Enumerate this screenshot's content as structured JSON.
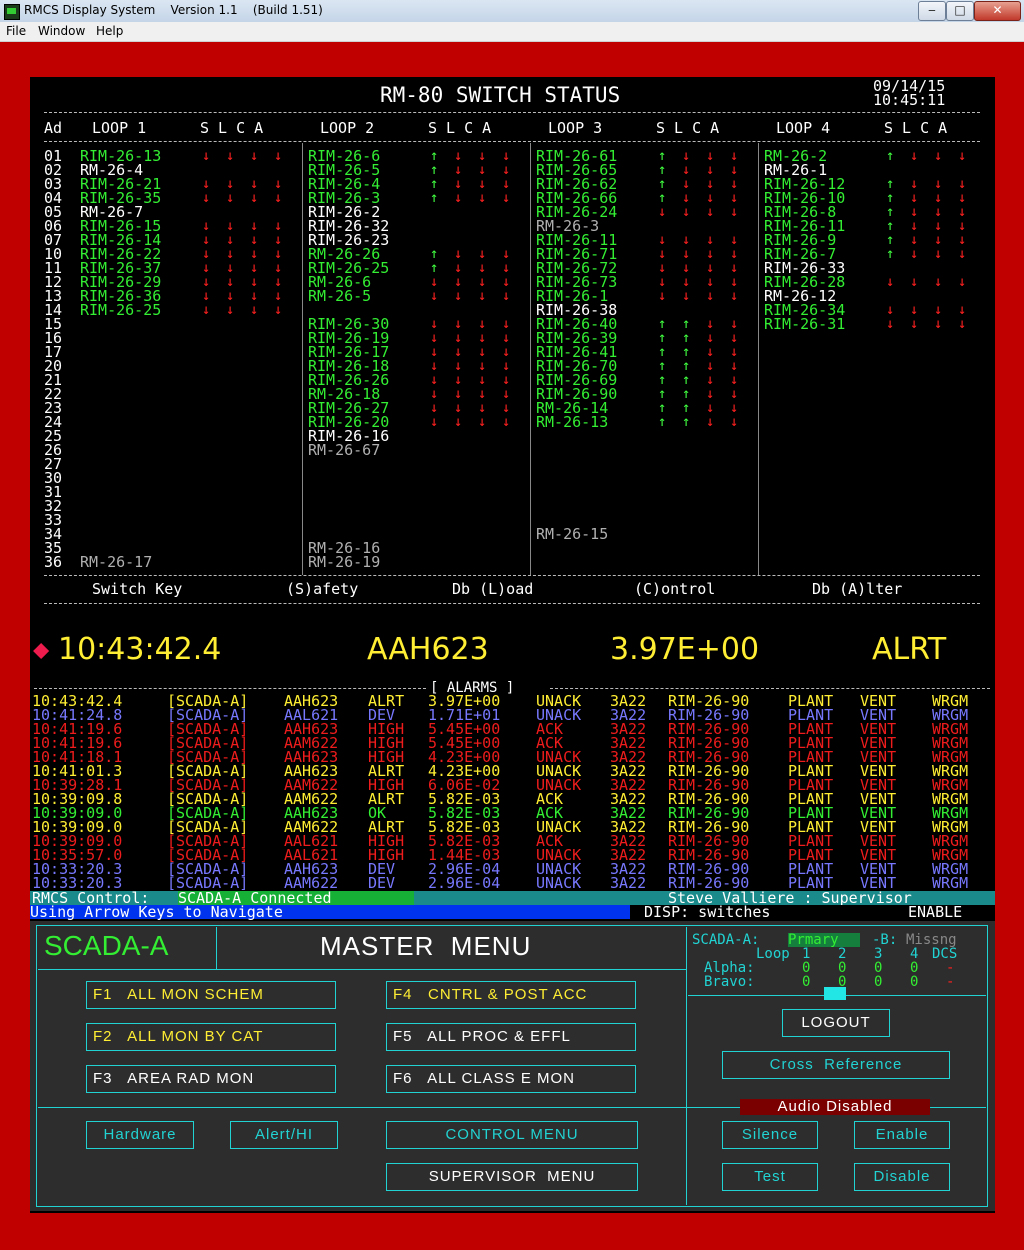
{
  "window": {
    "title": "RMCS Display System    Version 1.1    (Build 1.51)",
    "min": "‒",
    "max": "□",
    "close": "✕"
  },
  "menubar": {
    "file": "File",
    "window": "Window",
    "help": "Help"
  },
  "status_screen": {
    "title": "RM-80 SWITCH STATUS",
    "date": "09/14/15",
    "time": "10:45:11",
    "ad_header": "Ad",
    "slca_header": "S L C A",
    "loop_headers": [
      "LOOP 1",
      "LOOP 2",
      "LOOP 3",
      "LOOP 4"
    ],
    "addresses": [
      "01",
      "02",
      "03",
      "04",
      "05",
      "06",
      "07",
      "10",
      "11",
      "12",
      "13",
      "14",
      "15",
      "16",
      "17",
      "20",
      "21",
      "22",
      "23",
      "24",
      "25",
      "26",
      "27",
      "30",
      "31",
      "32",
      "33",
      "34",
      "35",
      "36"
    ],
    "loop1": [
      {
        "name": "RIM-26-13",
        "c": "g",
        "a": "dddd"
      },
      {
        "name": "RM-26-4",
        "c": "w",
        "a": ""
      },
      {
        "name": "RIM-26-21",
        "c": "g",
        "a": "dddd"
      },
      {
        "name": "RIM-26-35",
        "c": "g",
        "a": "dddd"
      },
      {
        "name": "RM-26-7",
        "c": "w",
        "a": ""
      },
      {
        "name": "RIM-26-15",
        "c": "g",
        "a": "dddd"
      },
      {
        "name": "RIM-26-14",
        "c": "g",
        "a": "dddd"
      },
      {
        "name": "RIM-26-22",
        "c": "g",
        "a": "dddd"
      },
      {
        "name": "RIM-26-37",
        "c": "g",
        "a": "dddd"
      },
      {
        "name": "RIM-26-29",
        "c": "g",
        "a": "dddd"
      },
      {
        "name": "RIM-26-36",
        "c": "g",
        "a": "dddd"
      },
      {
        "name": "RIM-26-25",
        "c": "g",
        "a": "dddd"
      },
      null,
      null,
      null,
      null,
      null,
      null,
      null,
      null,
      null,
      null,
      null,
      null,
      null,
      null,
      null,
      null,
      null,
      {
        "name": "RM-26-17",
        "c": "y",
        "a": ""
      }
    ],
    "loop2": [
      {
        "name": "RIM-26-6",
        "c": "g",
        "a": "uddd"
      },
      {
        "name": "RIM-26-5",
        "c": "g",
        "a": "uddd"
      },
      {
        "name": "RIM-26-4",
        "c": "g",
        "a": "uddd"
      },
      {
        "name": "RIM-26-3",
        "c": "g",
        "a": "uddd"
      },
      {
        "name": "RIM-26-2",
        "c": "w",
        "a": ""
      },
      {
        "name": "RIM-26-32",
        "c": "w",
        "a": ""
      },
      {
        "name": "RIM-26-23",
        "c": "w",
        "a": ""
      },
      {
        "name": "RM-26-26",
        "c": "g",
        "a": "uddd"
      },
      {
        "name": "RIM-26-25",
        "c": "g",
        "a": "uddd"
      },
      {
        "name": "RM-26-6",
        "c": "g",
        "a": "dddd"
      },
      {
        "name": "RM-26-5",
        "c": "g",
        "a": "dddd"
      },
      null,
      {
        "name": "RIM-26-30",
        "c": "g",
        "a": "dddd"
      },
      {
        "name": "RIM-26-19",
        "c": "g",
        "a": "dddd"
      },
      {
        "name": "RIM-26-17",
        "c": "g",
        "a": "dddd"
      },
      {
        "name": "RIM-26-18",
        "c": "g",
        "a": "dddd"
      },
      {
        "name": "RIM-26-26",
        "c": "g",
        "a": "dddd"
      },
      {
        "name": "RM-26-18",
        "c": "g",
        "a": "dddd"
      },
      {
        "name": "RIM-26-27",
        "c": "g",
        "a": "dddd"
      },
      {
        "name": "RIM-26-20",
        "c": "g",
        "a": "dddd"
      },
      {
        "name": "RIM-26-16",
        "c": "w",
        "a": ""
      },
      {
        "name": "RM-26-67",
        "c": "y",
        "a": ""
      },
      null,
      null,
      null,
      null,
      null,
      null,
      {
        "name": "RM-26-16",
        "c": "y",
        "a": ""
      },
      {
        "name": "RM-26-19",
        "c": "y",
        "a": ""
      }
    ],
    "loop3": [
      {
        "name": "RIM-26-61",
        "c": "g",
        "a": "uddd"
      },
      {
        "name": "RIM-26-65",
        "c": "g",
        "a": "uddd"
      },
      {
        "name": "RIM-26-62",
        "c": "g",
        "a": "uddd"
      },
      {
        "name": "RIM-26-66",
        "c": "g",
        "a": "uddd"
      },
      {
        "name": "RIM-26-24",
        "c": "g",
        "a": "dddd"
      },
      {
        "name": "RM-26-3",
        "c": "y",
        "a": ""
      },
      {
        "name": "RIM-26-11",
        "c": "g",
        "a": "dddd"
      },
      {
        "name": "RIM-26-71",
        "c": "g",
        "a": "dddd"
      },
      {
        "name": "RIM-26-72",
        "c": "g",
        "a": "dddd"
      },
      {
        "name": "RIM-26-73",
        "c": "g",
        "a": "dddd"
      },
      {
        "name": "RIM-26-1",
        "c": "g",
        "a": "dddd"
      },
      {
        "name": "RIM-26-38",
        "c": "w",
        "a": ""
      },
      {
        "name": "RIM-26-40",
        "c": "g",
        "a": "uudd"
      },
      {
        "name": "RIM-26-39",
        "c": "g",
        "a": "uudd"
      },
      {
        "name": "RIM-26-41",
        "c": "g",
        "a": "uudd"
      },
      {
        "name": "RIM-26-70",
        "c": "g",
        "a": "uudd"
      },
      {
        "name": "RIM-26-69",
        "c": "g",
        "a": "uudd"
      },
      {
        "name": "RIM-26-90",
        "c": "g",
        "a": "uudd"
      },
      {
        "name": "RM-26-14",
        "c": "g",
        "a": "uudd"
      },
      {
        "name": "RM-26-13",
        "c": "g",
        "a": "uudd"
      },
      null,
      null,
      null,
      null,
      null,
      null,
      null,
      {
        "name": "RM-26-15",
        "c": "y",
        "a": ""
      },
      null,
      null
    ],
    "loop4": [
      {
        "name": "RM-26-2",
        "c": "g",
        "a": "uddd"
      },
      {
        "name": "RM-26-1",
        "c": "w",
        "a": ""
      },
      {
        "name": "RIM-26-12",
        "c": "g",
        "a": "uddd"
      },
      {
        "name": "RIM-26-10",
        "c": "g",
        "a": "uddd"
      },
      {
        "name": "RIM-26-8",
        "c": "g",
        "a": "uddd"
      },
      {
        "name": "RIM-26-11",
        "c": "g",
        "a": "uddd"
      },
      {
        "name": "RIM-26-9",
        "c": "g",
        "a": "uddd"
      },
      {
        "name": "RIM-26-7",
        "c": "g",
        "a": "uddd"
      },
      {
        "name": "RIM-26-33",
        "c": "w",
        "a": ""
      },
      {
        "name": "RIM-26-28",
        "c": "g",
        "a": "dddd"
      },
      {
        "name": "RM-26-12",
        "c": "w",
        "a": ""
      },
      {
        "name": "RIM-26-34",
        "c": "g",
        "a": "dddd"
      },
      {
        "name": "RIM-26-31",
        "c": "g",
        "a": "dddd"
      }
    ],
    "key_legend": {
      "switch_key": "Switch Key",
      "safety": "(S)afety",
      "load": "Db (L)oad",
      "control": "(C)ontrol",
      "alter": "Db (A)lter"
    }
  },
  "latest_alarm": {
    "time": "10:43:42.4",
    "point": "AAH623",
    "value": "3.97E+00",
    "state": "ALRT"
  },
  "alarms": {
    "header": "[ ALARMS ]",
    "rows": [
      {
        "time": "10:43:42.4",
        "src": "[SCADA-A]",
        "pt": "AAH623",
        "type": "ALRT",
        "val": "3.97E+00",
        "ack": "UNACK",
        "code": "3A22",
        "dev": "RIM-26-90",
        "loc": "PLANT",
        "sys": "VENT",
        "grp": "WRGM",
        "color": "#ffee33"
      },
      {
        "time": "10:41:24.8",
        "src": "[SCADA-A]",
        "pt": "AAL621",
        "type": "DEV",
        "val": "1.71E+01",
        "ack": "UNACK",
        "code": "3A22",
        "dev": "RIM-26-90",
        "loc": "PLANT",
        "sys": "VENT",
        "grp": "WRGM",
        "color": "#7878ff"
      },
      {
        "time": "10:41:19.6",
        "src": "[SCADA-A]",
        "pt": "AAH623",
        "type": "HIGH",
        "val": "5.45E+00",
        "ack": "ACK",
        "code": "3A22",
        "dev": "RIM-26-90",
        "loc": "PLANT",
        "sys": "VENT",
        "grp": "WRGM",
        "color": "#ee1c1c"
      },
      {
        "time": "10:41:19.6",
        "src": "[SCADA-A]",
        "pt": "AAM622",
        "type": "HIGH",
        "val": "5.45E+00",
        "ack": "ACK",
        "code": "3A22",
        "dev": "RIM-26-90",
        "loc": "PLANT",
        "sys": "VENT",
        "grp": "WRGM",
        "color": "#ee1c1c"
      },
      {
        "time": "10:41:18.1",
        "src": "[SCADA-A]",
        "pt": "AAH623",
        "type": "HIGH",
        "val": "4.23E+00",
        "ack": "UNACK",
        "code": "3A22",
        "dev": "RIM-26-90",
        "loc": "PLANT",
        "sys": "VENT",
        "grp": "WRGM",
        "color": "#ee1c1c"
      },
      {
        "time": "10:41:01.3",
        "src": "[SCADA-A]",
        "pt": "AAH623",
        "type": "ALRT",
        "val": "4.23E+00",
        "ack": "UNACK",
        "code": "3A22",
        "dev": "RIM-26-90",
        "loc": "PLANT",
        "sys": "VENT",
        "grp": "WRGM",
        "color": "#ffee33"
      },
      {
        "time": "10:39:28.1",
        "src": "[SCADA-A]",
        "pt": "AAM622",
        "type": "HIGH",
        "val": "6.06E-02",
        "ack": "UNACK",
        "code": "3A22",
        "dev": "RIM-26-90",
        "loc": "PLANT",
        "sys": "VENT",
        "grp": "WRGM",
        "color": "#ee1c1c"
      },
      {
        "time": "10:39:09.8",
        "src": "[SCADA-A]",
        "pt": "AAM622",
        "type": "ALRT",
        "val": "5.82E-03",
        "ack": "ACK",
        "code": "3A22",
        "dev": "RIM-26-90",
        "loc": "PLANT",
        "sys": "VENT",
        "grp": "WRGM",
        "color": "#ffee33"
      },
      {
        "time": "10:39:09.0",
        "src": "[SCADA-A]",
        "pt": "AAH623",
        "type": "OK",
        "val": "5.82E-03",
        "ack": "ACK",
        "code": "3A22",
        "dev": "RIM-26-90",
        "loc": "PLANT",
        "sys": "VENT",
        "grp": "WRGM",
        "color": "#33ee33"
      },
      {
        "time": "10:39:09.0",
        "src": "[SCADA-A]",
        "pt": "AAM622",
        "type": "ALRT",
        "val": "5.82E-03",
        "ack": "UNACK",
        "code": "3A22",
        "dev": "RIM-26-90",
        "loc": "PLANT",
        "sys": "VENT",
        "grp": "WRGM",
        "color": "#ffee33"
      },
      {
        "time": "10:39:09.0",
        "src": "[SCADA-A]",
        "pt": "AAL621",
        "type": "HIGH",
        "val": "5.82E-03",
        "ack": "ACK",
        "code": "3A22",
        "dev": "RIM-26-90",
        "loc": "PLANT",
        "sys": "VENT",
        "grp": "WRGM",
        "color": "#ee1c1c"
      },
      {
        "time": "10:35:57.0",
        "src": "[SCADA-A]",
        "pt": "AAL621",
        "type": "HIGH",
        "val": "1.44E-03",
        "ack": "UNACK",
        "code": "3A22",
        "dev": "RIM-26-90",
        "loc": "PLANT",
        "sys": "VENT",
        "grp": "WRGM",
        "color": "#ee1c1c"
      },
      {
        "time": "10:33:20.3",
        "src": "[SCADA-A]",
        "pt": "AAH623",
        "type": "DEV",
        "val": "2.96E-04",
        "ack": "UNACK",
        "code": "3A22",
        "dev": "RIM-26-90",
        "loc": "PLANT",
        "sys": "VENT",
        "grp": "WRGM",
        "color": "#7878ff"
      },
      {
        "time": "10:33:20.3",
        "src": "[SCADA-A]",
        "pt": "AAM622",
        "type": "DEV",
        "val": "2.96E-04",
        "ack": "UNACK",
        "code": "3A22",
        "dev": "RIM-26-90",
        "loc": "PLANT",
        "sys": "VENT",
        "grp": "WRGM",
        "color": "#7878ff"
      }
    ]
  },
  "status_bar": {
    "control_label": "RMCS Control: ",
    "control_value": "SCADA-A Connected",
    "user": "Steve Valliere : Supervisor",
    "nav_hint": "Using Arrow Keys to Navigate",
    "disp": "DISP: switches",
    "enable": "ENABLE"
  },
  "master_menu": {
    "scada": "SCADA-A",
    "title": "MASTER  MENU",
    "f1": "F1   ALL MON SCHEM",
    "f2": "F2   ALL MON BY CAT",
    "f3": "F3   AREA RAD MON",
    "f4": "F4   CNTRL & POST ACC",
    "f5": "F5   ALL PROC & EFFL",
    "f6": "F6   ALL CLASS E MON",
    "hardware": "Hardware",
    "alert_hi": "Alert/HI",
    "control_menu": "CONTROL MENU",
    "supervisor_menu": "SUPERVISOR  MENU",
    "status_a_label": "SCADA-A:",
    "status_a_value": "Prmary",
    "status_b_label": "-B:",
    "status_b_value": "Missng",
    "loop_label": "Loop",
    "loop_nums": [
      "1",
      "2",
      "3",
      "4"
    ],
    "dcs": "DCS",
    "alpha": "Alpha:",
    "bravo": "Bravo:",
    "alpha_vals": [
      "0",
      "0",
      "0",
      "0"
    ],
    "bravo_vals": [
      "0",
      "0",
      "0",
      "0"
    ],
    "alpha_dcs": "-",
    "bravo_dcs": "-",
    "logout": "LOGOUT",
    "cross_reference": "Cross  Reference",
    "audio": "Audio Disabled",
    "silence": "Silence",
    "enable": "Enable",
    "test": "Test",
    "disable": "Disable"
  },
  "colors": {
    "green": "#33ee33",
    "white": "#ffffff",
    "gray": "#b0b0b0",
    "red": "#ff2020",
    "yellow": "#ffee33",
    "cyan": "#22d3d3",
    "bg": "#000000",
    "frame": "#c00000"
  }
}
